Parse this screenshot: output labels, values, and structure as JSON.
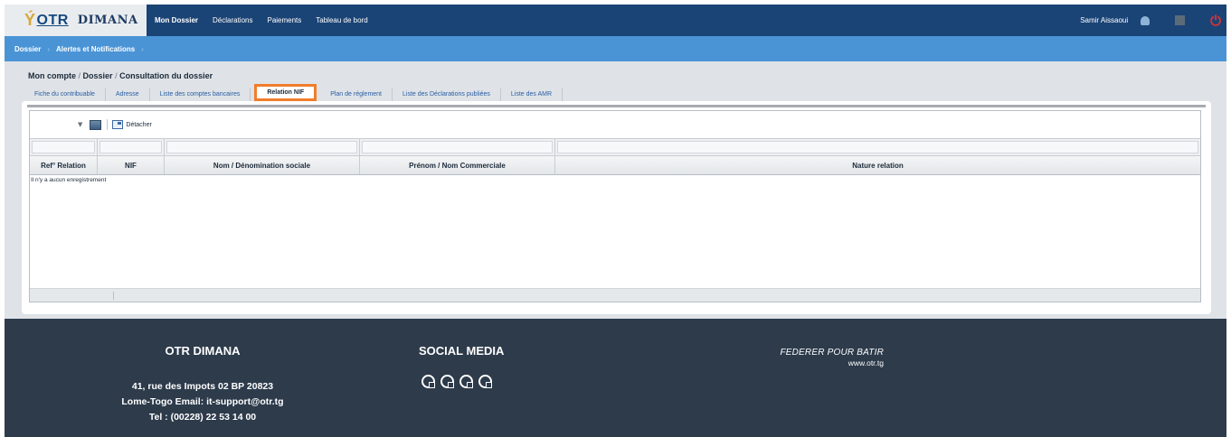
{
  "header": {
    "logo_otr": "OTR",
    "logo_app": "DIMANA",
    "nav": [
      "Mon Dossier",
      "Déclarations",
      "Paiements",
      "Tableau de bord"
    ],
    "user_name": "Samir Aissaoui"
  },
  "subnav": {
    "items": [
      "Dossier",
      "Alertes et Notifications"
    ],
    "separator": "›"
  },
  "breadcrumb": {
    "part1": "Mon compte",
    "part2": "Dossier",
    "part3": "Consultation du dossier",
    "separator": "/"
  },
  "tabs": [
    "Fiche du contribuable",
    "Adresse",
    "Liste des comptes bancaires",
    "Relation NIF",
    "Plan de réglement",
    "Liste des Déclarations publiées",
    "Liste des AMR"
  ],
  "active_tab_index": 3,
  "toolbar": {
    "detach_label": "Détacher"
  },
  "table": {
    "columns": [
      "Ref° Relation",
      "NIF",
      "Nom / Dénomination sociale",
      "Prénom / Nom Commerciale",
      "Nature relation"
    ],
    "empty_message": "Il n'y a aucun enregistrement"
  },
  "footer": {
    "title": "OTR DIMANA",
    "address_line1": "41, rue des Impots 02 BP 20823",
    "address_line2": "Lome-Togo Email: it-support@otr.tg",
    "address_line3": "Tel : (00228) 22 53 14 00",
    "social_title": "SOCIAL MEDIA",
    "motto": "FEDERER POUR BATIR",
    "website": "www.otr.tg"
  },
  "colors": {
    "topbar": "#1b4476",
    "subbar": "#4a94d6",
    "active_tab_border": "#f07d2a",
    "footer": "#2d3b4b",
    "power_icon": "#e03131"
  },
  "icons": [
    "person-icon",
    "window-icon",
    "power-icon",
    "table-settings-icon",
    "detach-icon",
    "facebook-icon",
    "twitter-icon",
    "linkedin-icon",
    "youtube-icon"
  ]
}
